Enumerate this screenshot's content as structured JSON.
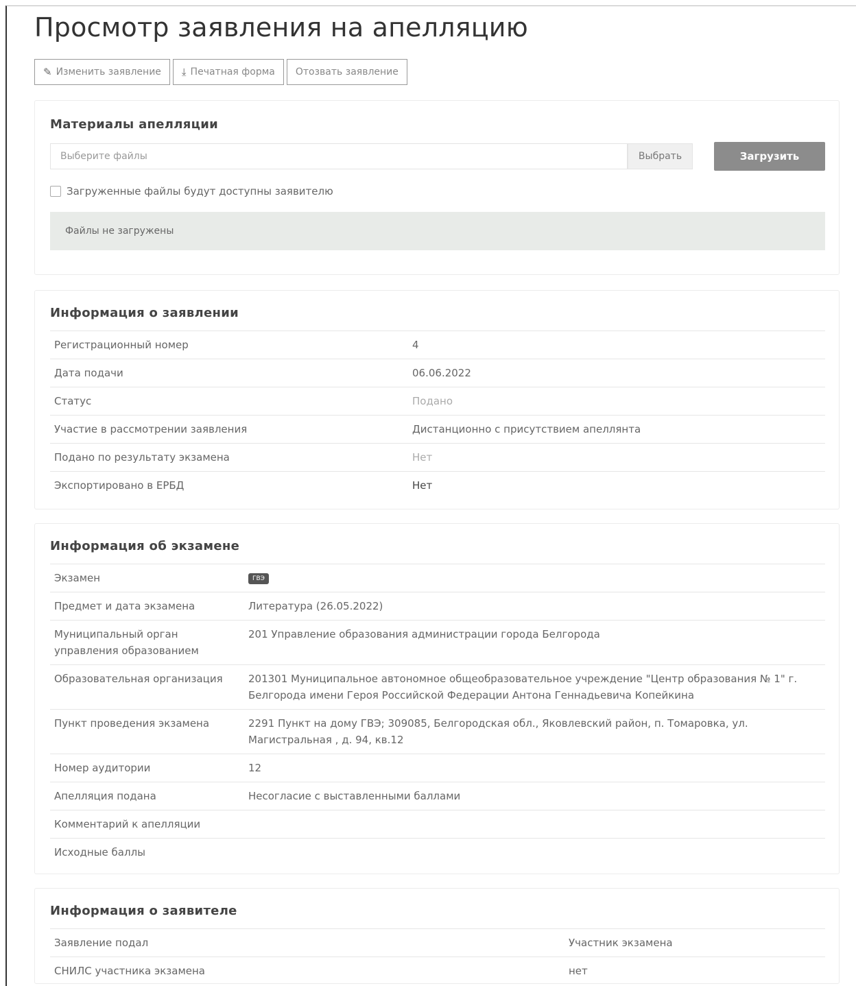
{
  "page": {
    "title": "Просмотр заявления на апелляцию"
  },
  "toolbar": {
    "edit_label": "Изменить заявление",
    "print_label": "Печатная форма",
    "withdraw_label": "Отозвать заявление"
  },
  "materials": {
    "heading": "Материалы апелляции",
    "file_placeholder": "Выберите файлы",
    "choose_label": "Выбрать",
    "upload_label": "Загрузить",
    "checkbox_label": "Загруженные файлы будут доступны заявителю",
    "empty_message": "Файлы не загружены"
  },
  "application_info": {
    "heading": "Информация о заявлении",
    "rows": [
      {
        "key": "Регистрационный номер",
        "value": "4"
      },
      {
        "key": "Дата подачи",
        "value": "06.06.2022"
      },
      {
        "key": "Статус",
        "value": "Подано"
      },
      {
        "key": "Участие в рассмотрении заявления",
        "value": "Дистанционно с присутствием апеллянта"
      },
      {
        "key": "Подано по результату экзамена",
        "value": "Нет"
      },
      {
        "key": "Экспортировано в ЕРБД",
        "value": "Нет"
      }
    ]
  },
  "exam_info": {
    "heading": "Информация об экзамене",
    "exam_badge": "ГВЭ",
    "rows": [
      {
        "key": "Экзамен",
        "value": ""
      },
      {
        "key": "Предмет и дата экзамена",
        "value": "Литература (26.05.2022)"
      },
      {
        "key": "Муниципальный орган управления образованием",
        "value": "201 Управление образования администрации города Белгорода"
      },
      {
        "key": "Образовательная организация",
        "value": "201301 Муниципальное автономное общеобразовательное учреждение \"Центр образования № 1\" г. Белгорода имени Героя Российской Федерации Антона Геннадьевича Копейкина"
      },
      {
        "key": "Пункт проведения экзамена",
        "value": "2291 Пункт на дому ГВЭ; 309085, Белгородская обл., Яковлевский район, п. Томаровка, ул. Магистральная , д. 94, кв.12"
      },
      {
        "key": "Номер аудитории",
        "value": "12"
      },
      {
        "key": "Апелляция подана",
        "value": "Несогласие с выставленными баллами"
      },
      {
        "key": "Комментарий к апелляции",
        "value": ""
      },
      {
        "key": "Исходные баллы",
        "value": ""
      }
    ]
  },
  "applicant_info": {
    "heading": "Информация о заявителе",
    "rows": [
      {
        "key": "Заявление подал",
        "value": "Участник экзамена"
      },
      {
        "key": "СНИЛС участника экзамена",
        "value": "нет"
      }
    ]
  }
}
